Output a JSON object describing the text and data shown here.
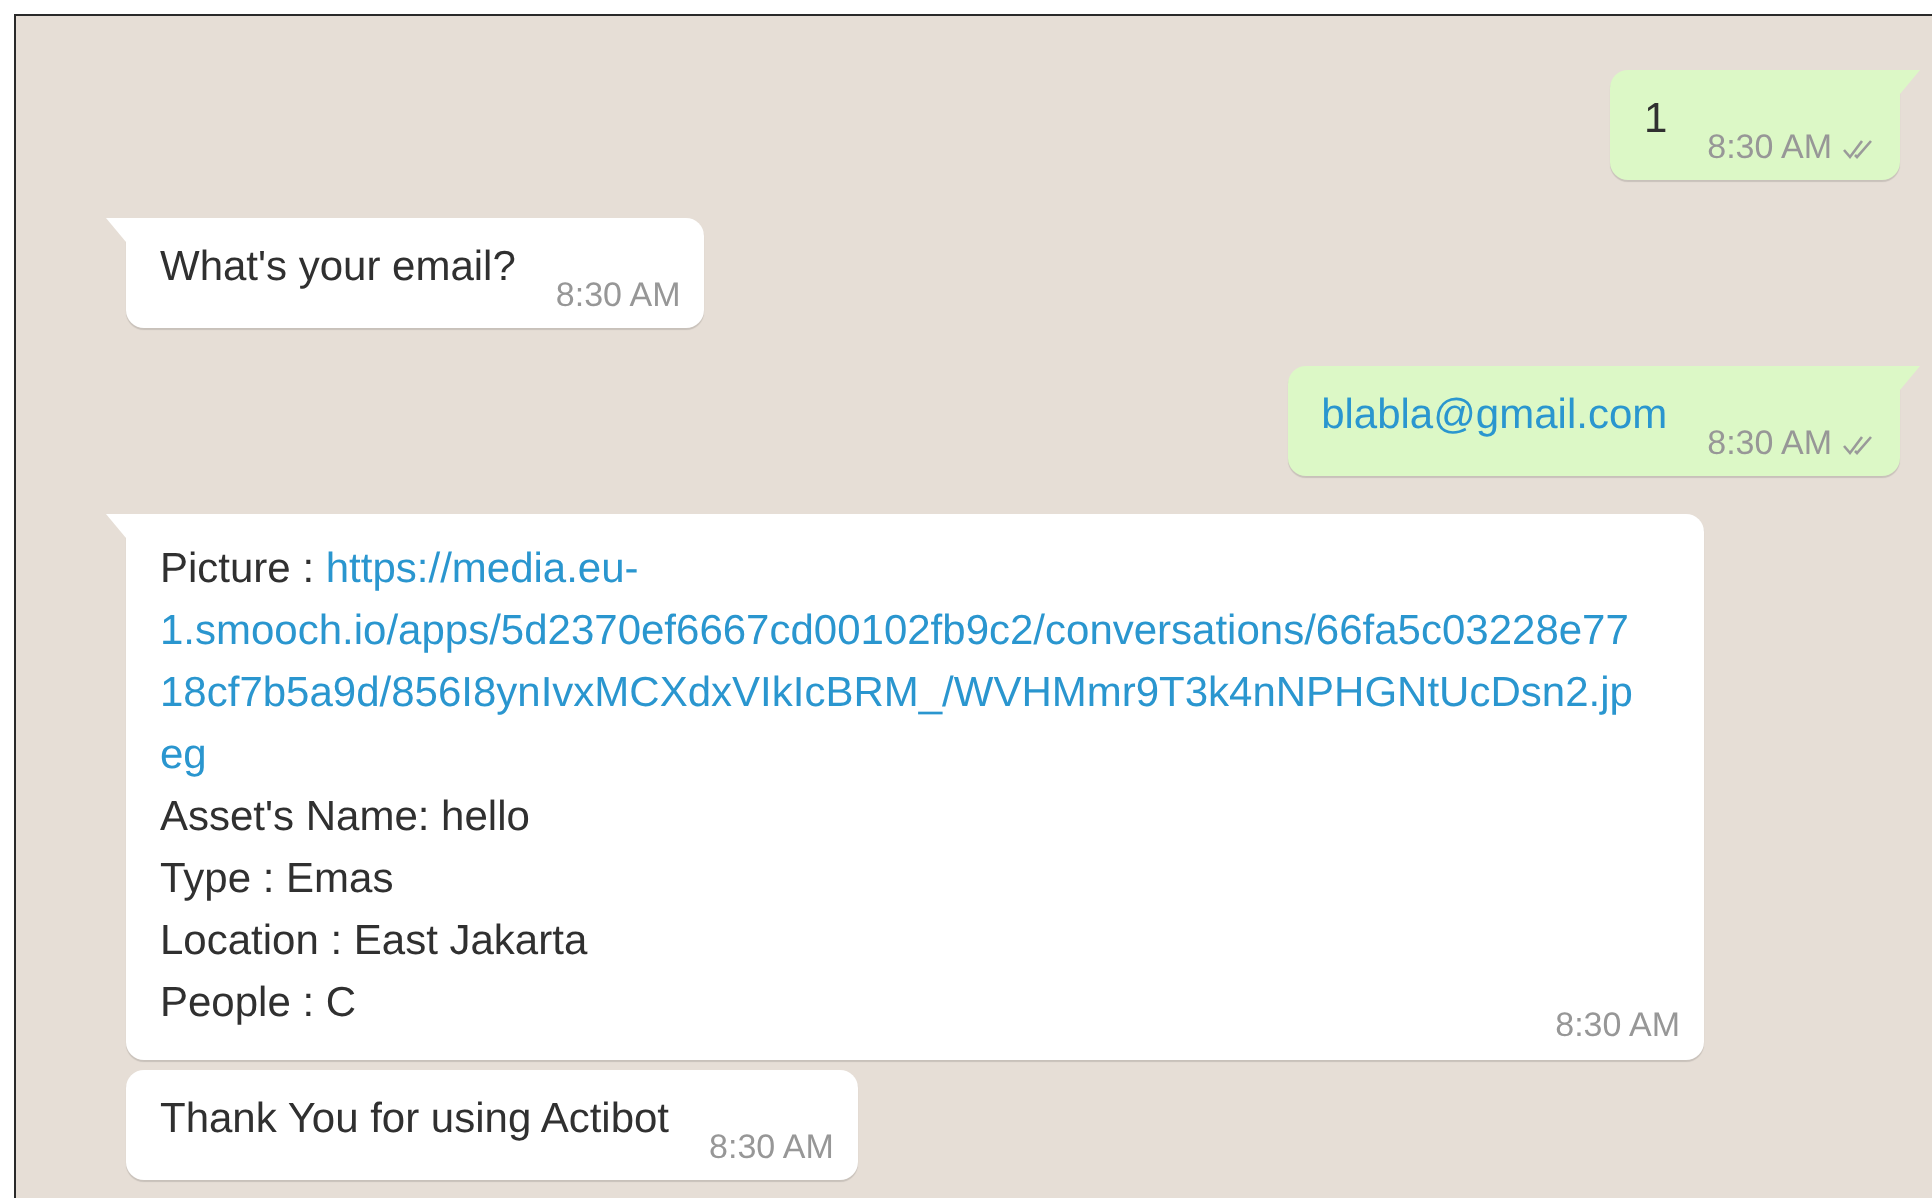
{
  "messages": [
    {
      "kind": "outgoing",
      "tail": true,
      "read": false,
      "time": "8:30 AM",
      "lines": [
        [
          {
            "kind": "text",
            "text": "1"
          }
        ]
      ]
    },
    {
      "kind": "incoming",
      "tail": true,
      "time": "8:30 AM",
      "lines": [
        [
          {
            "kind": "text",
            "text": "What's your email?"
          }
        ]
      ]
    },
    {
      "kind": "outgoing",
      "tail": true,
      "read": false,
      "time": "8:30 AM",
      "lines": [
        [
          {
            "kind": "link",
            "text": "blabla@gmail.com"
          }
        ]
      ]
    },
    {
      "kind": "incoming",
      "tail": true,
      "time": "8:30 AM",
      "lines": [
        [
          {
            "kind": "text",
            "text": "Picture : "
          },
          {
            "kind": "link",
            "text": "https://media.eu-1.smooch.io/apps/5d2370ef6667cd00102fb9c2/conversations/66fa5c03228e7718cf7b5a9d/856I8ynIvxMCXdxVIkIcBRM_/WVHMmr9T3k4nNPHGNtUcDsn2.jpeg"
          }
        ],
        [
          {
            "kind": "text",
            "text": "Asset's Name: hello"
          }
        ],
        [
          {
            "kind": "text",
            "text": "Type : Emas"
          }
        ],
        [
          {
            "kind": "text",
            "text": "Location : East Jakarta"
          }
        ],
        [
          {
            "kind": "text",
            "text": "People : C"
          }
        ]
      ]
    },
    {
      "kind": "incoming",
      "tail": false,
      "time": "8:30 AM",
      "lines": [
        [
          {
            "kind": "text",
            "text": "Thank You for using Actibot"
          }
        ]
      ]
    }
  ]
}
